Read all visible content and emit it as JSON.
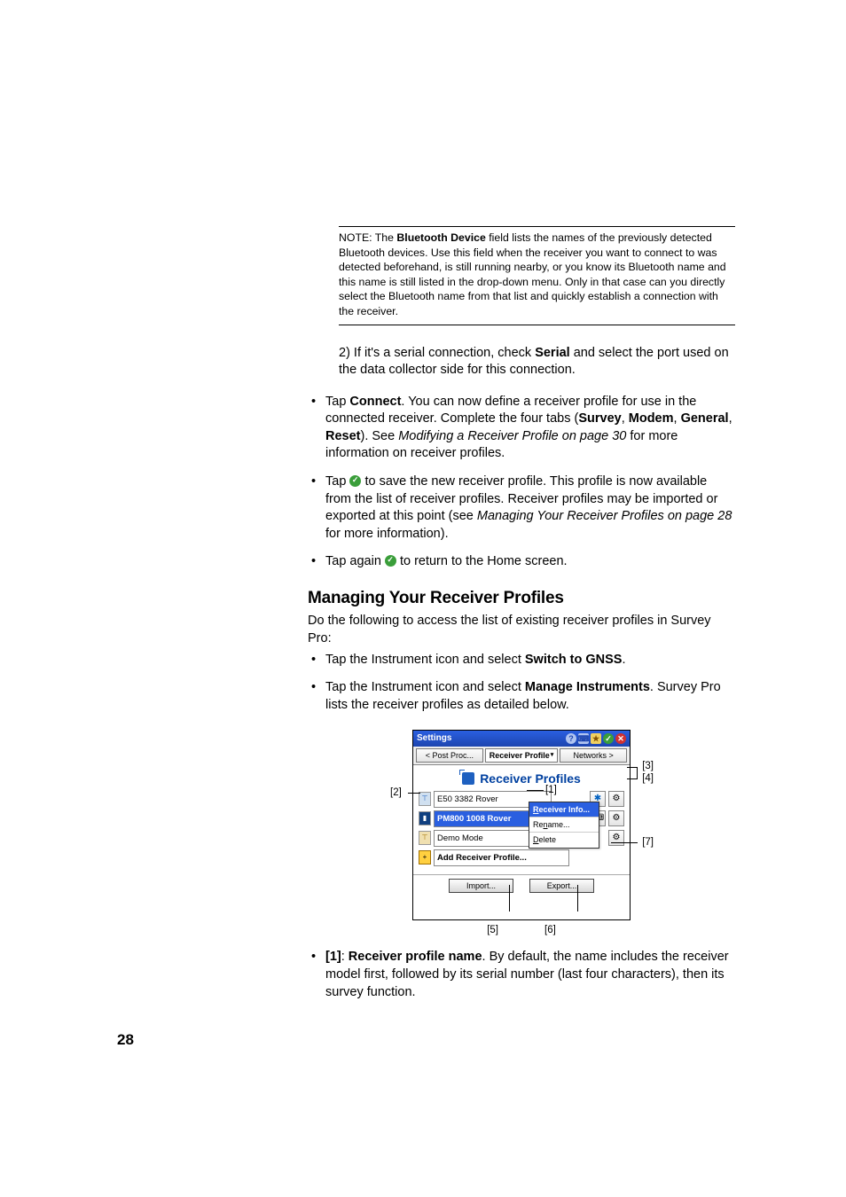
{
  "note": {
    "prefix": "NOTE: The ",
    "bold1": "Bluetooth Device",
    "rest": " field lists the names of the previously detected Bluetooth devices. Use this field when the receiver you want to connect to was detected beforehand, is still running nearby, or you know its Bluetooth name and this name is still listed in the drop-down menu. Only in that case can you directly select the Bluetooth name from that list and quickly establish a connection with the receiver."
  },
  "step2": {
    "pre": "2) If it's a serial connection, check ",
    "bold": "Serial",
    "post": " and select the port used on the data collector side for this connection."
  },
  "b1": {
    "a": "Tap ",
    "b": "Connect",
    "c": ". You can now define a receiver profile for use in the connected receiver. Complete the four tabs (",
    "t1": "Survey",
    "sep": ", ",
    "t2": "Modem",
    "t3": "General",
    "t4": "Reset",
    "d": "). See ",
    "i": "Modifying a Receiver Profile on page 30",
    "e": " for more information on receiver profiles."
  },
  "b2": {
    "a": "Tap ",
    "b": " to save the new receiver profile. This profile is now available from the list of receiver profiles. Receiver profiles may be imported or exported at this point (see ",
    "i": "Managing Your Receiver Profiles on page 28",
    "c": " for more information)."
  },
  "b3": {
    "a": "Tap again ",
    "b": " to return to the Home screen."
  },
  "heading": "Managing Your Receiver Profiles",
  "intro": "Do the following to access the list of existing receiver profiles in Survey Pro:",
  "s1": {
    "a": "Tap the Instrument icon and select ",
    "b": "Switch to GNSS",
    "c": "."
  },
  "s2": {
    "a": "Tap the Instrument icon and select ",
    "b": "Manage Instruments",
    "c": ". Survey Pro lists the receiver profiles as detailed below."
  },
  "shot": {
    "title": "Settings",
    "tab_prev": "< Post Proc...",
    "tab_active": "Receiver Profile",
    "tab_next": "Networks >",
    "panel_title": "Receiver Profiles",
    "rows": {
      "r1": "E50 3382 Rover",
      "r2": "PM800 1008 Rover",
      "r3": "Demo Mode",
      "r4": "Add Receiver Profile..."
    },
    "context": {
      "c1_pre": "R",
      "c1_rest": "eceiver Info...",
      "c2_pre": "n",
      "c2_label": "Rename...",
      "c3_pre": "D",
      "c3_rest": "elete"
    },
    "import": "Import...",
    "export": "Export..."
  },
  "callouts": {
    "c1": "[1]",
    "c2": "[2]",
    "c3": "[3]",
    "c4": "[4]",
    "c5": "[5]",
    "c6": "[6]",
    "c7": "[7]"
  },
  "f1": {
    "label": "[1]",
    "bold": "Receiver profile name",
    "text": ". By default, the name includes the receiver model first, followed by its serial number (last four characters), then its survey function."
  },
  "page_number": "28"
}
